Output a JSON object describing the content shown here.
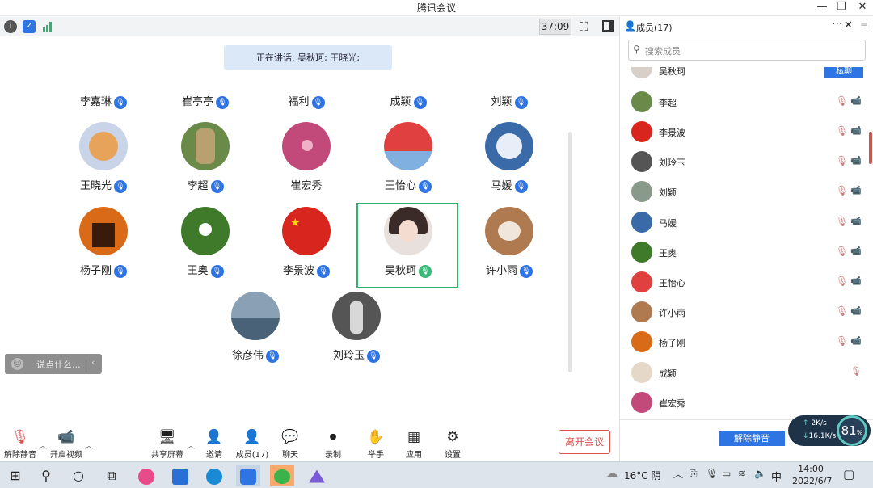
{
  "window": {
    "title": "腾讯会议"
  },
  "toolbar": {
    "timer": "37:09"
  },
  "stage": {
    "speaking": "正在讲话: 吴秋珂; 王晓光;",
    "top_row": [
      "李嘉琳",
      "崔亭亭",
      "福利",
      "成颖",
      "刘颖"
    ],
    "tiles": [
      {
        "name": "王晓光",
        "mic": "on",
        "color": "#c9d4e8",
        "inner": "#e8a35a"
      },
      {
        "name": "李超",
        "mic": "on",
        "color": "#6a8a4a",
        "inner": "#b9a070"
      },
      {
        "name": "崔宏秀",
        "mic": "none",
        "color": "#c24a7a",
        "inner": "#f0b0c8"
      },
      {
        "name": "王怡心",
        "mic": "on",
        "color": "#e04040",
        "inner": "#80b0e0"
      },
      {
        "name": "马媛",
        "mic": "on",
        "color": "#3a6aa8",
        "inner": "#e8eef8"
      },
      {
        "name": "杨子刚",
        "mic": "on",
        "color": "#d96a18",
        "inner": "#3a1a08"
      },
      {
        "name": "王奥",
        "mic": "on",
        "color": "#3f7a2a",
        "inner": "#ffffff"
      },
      {
        "name": "李景波",
        "mic": "on",
        "color": "#d8261e",
        "inner": "#ffde00"
      },
      {
        "name": "吴秋珂",
        "mic": "speaking",
        "color": "#e8e0dc",
        "inner": "#3a2a28"
      },
      {
        "name": "许小雨",
        "mic": "on",
        "color": "#b07a50",
        "inner": "#f0e6dc"
      },
      {
        "name": "徐彦伟",
        "mic": "on",
        "color": "#8aa0b4",
        "inner": "#4a6278"
      },
      {
        "name": "刘玲玉",
        "mic": "on",
        "color": "#555555",
        "inner": "#d8d8d8"
      }
    ],
    "chat_placeholder": "说点什么..."
  },
  "controls": {
    "unmute": "解除静音",
    "video": "开启视频",
    "share": "共享屏幕",
    "invite": "邀请",
    "members": "成员(17)",
    "chat": "聊天",
    "record": "录制",
    "raise_hand": "举手",
    "apps": "应用",
    "settings": "设置",
    "leave": "离开会议"
  },
  "panel": {
    "header": "成员(17)",
    "search_placeholder": "搜索成员",
    "first_partial": "吴秋珂",
    "first_badge": "私聊",
    "members": [
      {
        "name": "李超",
        "color": "#6a8a4a"
      },
      {
        "name": "李景波",
        "color": "#d8261e"
      },
      {
        "name": "刘玲玉",
        "color": "#555555"
      },
      {
        "name": "刘颖",
        "color": "#8a9a8a"
      },
      {
        "name": "马媛",
        "color": "#3a6aa8"
      },
      {
        "name": "王奥",
        "color": "#3f7a2a"
      },
      {
        "name": "王怡心",
        "color": "#e04040"
      },
      {
        "name": "许小雨",
        "color": "#b07a50"
      },
      {
        "name": "杨子刚",
        "color": "#d96a18"
      },
      {
        "name": "成颖",
        "color": "#e6d8c8"
      },
      {
        "name": "崔宏秀",
        "color": "#c24a7a"
      }
    ],
    "unmute_all": "解除静音"
  },
  "net": {
    "up": "2K/s",
    "down": "16.1K/s",
    "percent": "81",
    "percent_unit": "%"
  },
  "taskbar": {
    "weather": "16°C 阴",
    "ime": "中",
    "time": "14:00",
    "date": "2022/6/7"
  }
}
